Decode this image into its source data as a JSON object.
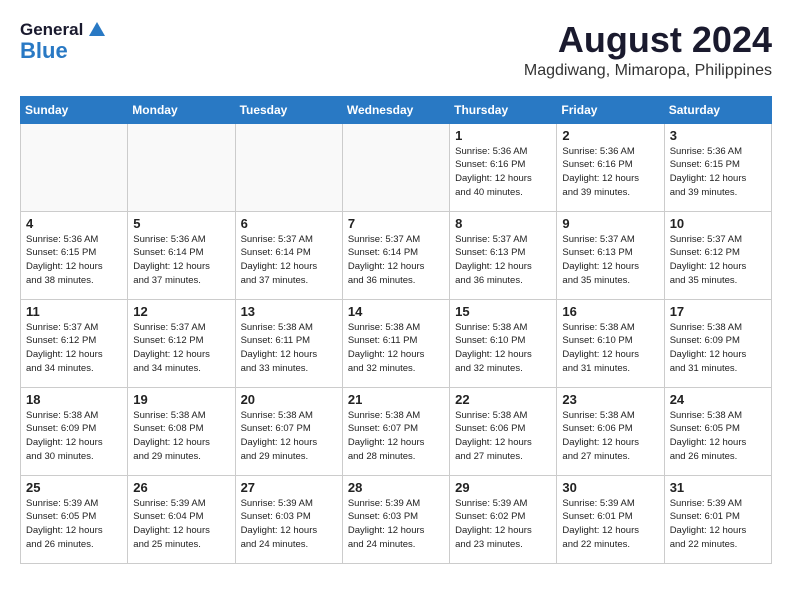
{
  "logo": {
    "general": "General",
    "blue": "Blue"
  },
  "title": "August 2024",
  "location": "Magdiwang, Mimaropa, Philippines",
  "weekdays": [
    "Sunday",
    "Monday",
    "Tuesday",
    "Wednesday",
    "Thursday",
    "Friday",
    "Saturday"
  ],
  "weeks": [
    [
      {
        "day": "",
        "info": ""
      },
      {
        "day": "",
        "info": ""
      },
      {
        "day": "",
        "info": ""
      },
      {
        "day": "",
        "info": ""
      },
      {
        "day": "1",
        "info": "Sunrise: 5:36 AM\nSunset: 6:16 PM\nDaylight: 12 hours\nand 40 minutes."
      },
      {
        "day": "2",
        "info": "Sunrise: 5:36 AM\nSunset: 6:16 PM\nDaylight: 12 hours\nand 39 minutes."
      },
      {
        "day": "3",
        "info": "Sunrise: 5:36 AM\nSunset: 6:15 PM\nDaylight: 12 hours\nand 39 minutes."
      }
    ],
    [
      {
        "day": "4",
        "info": "Sunrise: 5:36 AM\nSunset: 6:15 PM\nDaylight: 12 hours\nand 38 minutes."
      },
      {
        "day": "5",
        "info": "Sunrise: 5:36 AM\nSunset: 6:14 PM\nDaylight: 12 hours\nand 37 minutes."
      },
      {
        "day": "6",
        "info": "Sunrise: 5:37 AM\nSunset: 6:14 PM\nDaylight: 12 hours\nand 37 minutes."
      },
      {
        "day": "7",
        "info": "Sunrise: 5:37 AM\nSunset: 6:14 PM\nDaylight: 12 hours\nand 36 minutes."
      },
      {
        "day": "8",
        "info": "Sunrise: 5:37 AM\nSunset: 6:13 PM\nDaylight: 12 hours\nand 36 minutes."
      },
      {
        "day": "9",
        "info": "Sunrise: 5:37 AM\nSunset: 6:13 PM\nDaylight: 12 hours\nand 35 minutes."
      },
      {
        "day": "10",
        "info": "Sunrise: 5:37 AM\nSunset: 6:12 PM\nDaylight: 12 hours\nand 35 minutes."
      }
    ],
    [
      {
        "day": "11",
        "info": "Sunrise: 5:37 AM\nSunset: 6:12 PM\nDaylight: 12 hours\nand 34 minutes."
      },
      {
        "day": "12",
        "info": "Sunrise: 5:37 AM\nSunset: 6:12 PM\nDaylight: 12 hours\nand 34 minutes."
      },
      {
        "day": "13",
        "info": "Sunrise: 5:38 AM\nSunset: 6:11 PM\nDaylight: 12 hours\nand 33 minutes."
      },
      {
        "day": "14",
        "info": "Sunrise: 5:38 AM\nSunset: 6:11 PM\nDaylight: 12 hours\nand 32 minutes."
      },
      {
        "day": "15",
        "info": "Sunrise: 5:38 AM\nSunset: 6:10 PM\nDaylight: 12 hours\nand 32 minutes."
      },
      {
        "day": "16",
        "info": "Sunrise: 5:38 AM\nSunset: 6:10 PM\nDaylight: 12 hours\nand 31 minutes."
      },
      {
        "day": "17",
        "info": "Sunrise: 5:38 AM\nSunset: 6:09 PM\nDaylight: 12 hours\nand 31 minutes."
      }
    ],
    [
      {
        "day": "18",
        "info": "Sunrise: 5:38 AM\nSunset: 6:09 PM\nDaylight: 12 hours\nand 30 minutes."
      },
      {
        "day": "19",
        "info": "Sunrise: 5:38 AM\nSunset: 6:08 PM\nDaylight: 12 hours\nand 29 minutes."
      },
      {
        "day": "20",
        "info": "Sunrise: 5:38 AM\nSunset: 6:07 PM\nDaylight: 12 hours\nand 29 minutes."
      },
      {
        "day": "21",
        "info": "Sunrise: 5:38 AM\nSunset: 6:07 PM\nDaylight: 12 hours\nand 28 minutes."
      },
      {
        "day": "22",
        "info": "Sunrise: 5:38 AM\nSunset: 6:06 PM\nDaylight: 12 hours\nand 27 minutes."
      },
      {
        "day": "23",
        "info": "Sunrise: 5:38 AM\nSunset: 6:06 PM\nDaylight: 12 hours\nand 27 minutes."
      },
      {
        "day": "24",
        "info": "Sunrise: 5:38 AM\nSunset: 6:05 PM\nDaylight: 12 hours\nand 26 minutes."
      }
    ],
    [
      {
        "day": "25",
        "info": "Sunrise: 5:39 AM\nSunset: 6:05 PM\nDaylight: 12 hours\nand 26 minutes."
      },
      {
        "day": "26",
        "info": "Sunrise: 5:39 AM\nSunset: 6:04 PM\nDaylight: 12 hours\nand 25 minutes."
      },
      {
        "day": "27",
        "info": "Sunrise: 5:39 AM\nSunset: 6:03 PM\nDaylight: 12 hours\nand 24 minutes."
      },
      {
        "day": "28",
        "info": "Sunrise: 5:39 AM\nSunset: 6:03 PM\nDaylight: 12 hours\nand 24 minutes."
      },
      {
        "day": "29",
        "info": "Sunrise: 5:39 AM\nSunset: 6:02 PM\nDaylight: 12 hours\nand 23 minutes."
      },
      {
        "day": "30",
        "info": "Sunrise: 5:39 AM\nSunset: 6:01 PM\nDaylight: 12 hours\nand 22 minutes."
      },
      {
        "day": "31",
        "info": "Sunrise: 5:39 AM\nSunset: 6:01 PM\nDaylight: 12 hours\nand 22 minutes."
      }
    ]
  ]
}
